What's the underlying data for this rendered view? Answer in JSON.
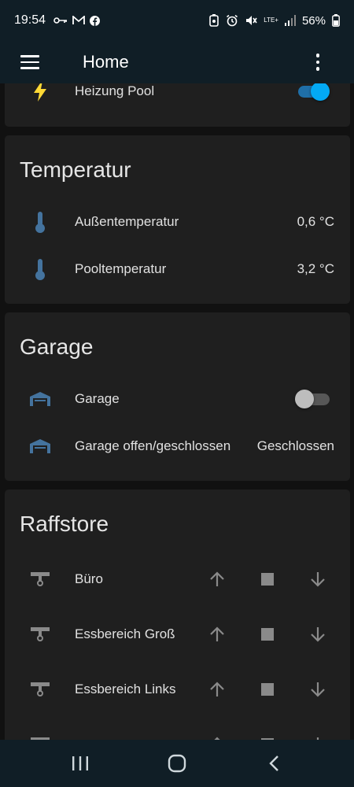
{
  "status_bar": {
    "time": "19:54",
    "left_icons": [
      "key-icon",
      "gmail-icon",
      "facebook-icon"
    ],
    "network": "LTE+",
    "battery": "56%"
  },
  "app_bar": {
    "title": "Home"
  },
  "cards": {
    "top_partial": {
      "row": {
        "label": "Heizung Pool",
        "icon": "flash-icon",
        "toggle_on": true
      }
    },
    "temperatur": {
      "title": "Temperatur",
      "rows": [
        {
          "label": "Außentemperatur",
          "value": "0,6 °C",
          "icon": "thermometer-icon"
        },
        {
          "label": "Pooltemperatur",
          "value": "3,2 °C",
          "icon": "thermometer-icon"
        }
      ]
    },
    "garage": {
      "title": "Garage",
      "rows": [
        {
          "label": "Garage",
          "icon": "garage-icon",
          "toggle_on": false
        },
        {
          "label": "Garage offen/geschlossen",
          "value": "Geschlossen",
          "icon": "garage-icon"
        }
      ]
    },
    "raffstore": {
      "title": "Raffstore",
      "rows": [
        {
          "label": "Büro",
          "icon": "blinds-icon"
        },
        {
          "label": "Essbereich Groß",
          "icon": "blinds-icon"
        },
        {
          "label": "Essbereich Links",
          "icon": "blinds-icon"
        }
      ]
    }
  },
  "colors": {
    "app_bar": "#101e26",
    "background": "#111111",
    "card": "#1f1f1f",
    "accent": "#03a9f4",
    "icon_blue": "#44739e",
    "flash_yellow": "#fdd835"
  }
}
